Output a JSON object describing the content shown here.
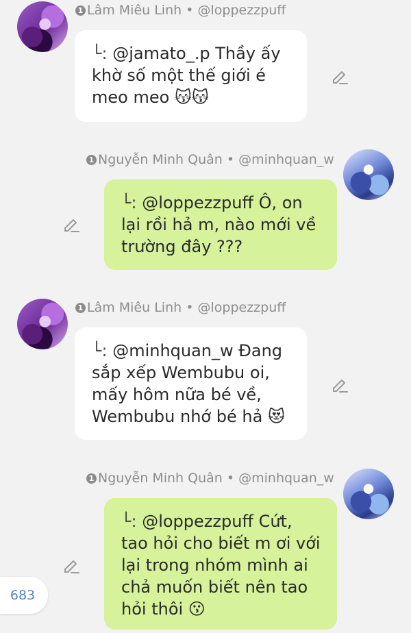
{
  "messages": [
    {
      "author_rank": "1",
      "author_name": "Lâm Miêu Linh",
      "separator": "•",
      "author_handle": "@loppezzpuff",
      "reply_mark": "└:",
      "lines": [
        "@jamato_.p Thầy ấy",
        "khờ số một thế giới é",
        "meo meo 😽😽"
      ]
    },
    {
      "author_rank": "1",
      "author_name": "Nguyễn Minh Quân",
      "separator": "•",
      "author_handle": "@minhquan_w",
      "reply_mark": "└:",
      "lines": [
        "@loppezzpuff Ô, on",
        "lại rồi hả m, nào mới về",
        "trường đây ???"
      ]
    },
    {
      "author_rank": "1",
      "author_name": "Lâm Miêu Linh",
      "separator": "•",
      "author_handle": "@loppezzpuff",
      "reply_mark": "└:",
      "lines": [
        "@minhquan_w Đang",
        "sắp xếp Wembubu oi,",
        "mấy hôm nữa bé về,",
        "Wembubu nhớ bé hả 😻"
      ]
    },
    {
      "author_rank": "1",
      "author_name": "Nguyễn Minh Quân",
      "separator": "•",
      "author_handle": "@minhquan_w",
      "reply_mark": "└:",
      "lines": [
        "@loppezzpuff Cứt,",
        "tao hỏi cho biết m ơi với",
        "lại trong nhóm mình ai",
        "chả muốn biết nên tao",
        "hỏi thôi 😗"
      ]
    }
  ],
  "comment_count": "683",
  "icons": {
    "edit": "pencil-edit-icon",
    "rank": "rank-badge-icon"
  },
  "colors": {
    "background": "#f2f2f2",
    "bubble_left": "#ffffff",
    "bubble_right": "#d6f29b",
    "meta_text": "#8d8d8d",
    "count_text": "#4e86c4"
  }
}
